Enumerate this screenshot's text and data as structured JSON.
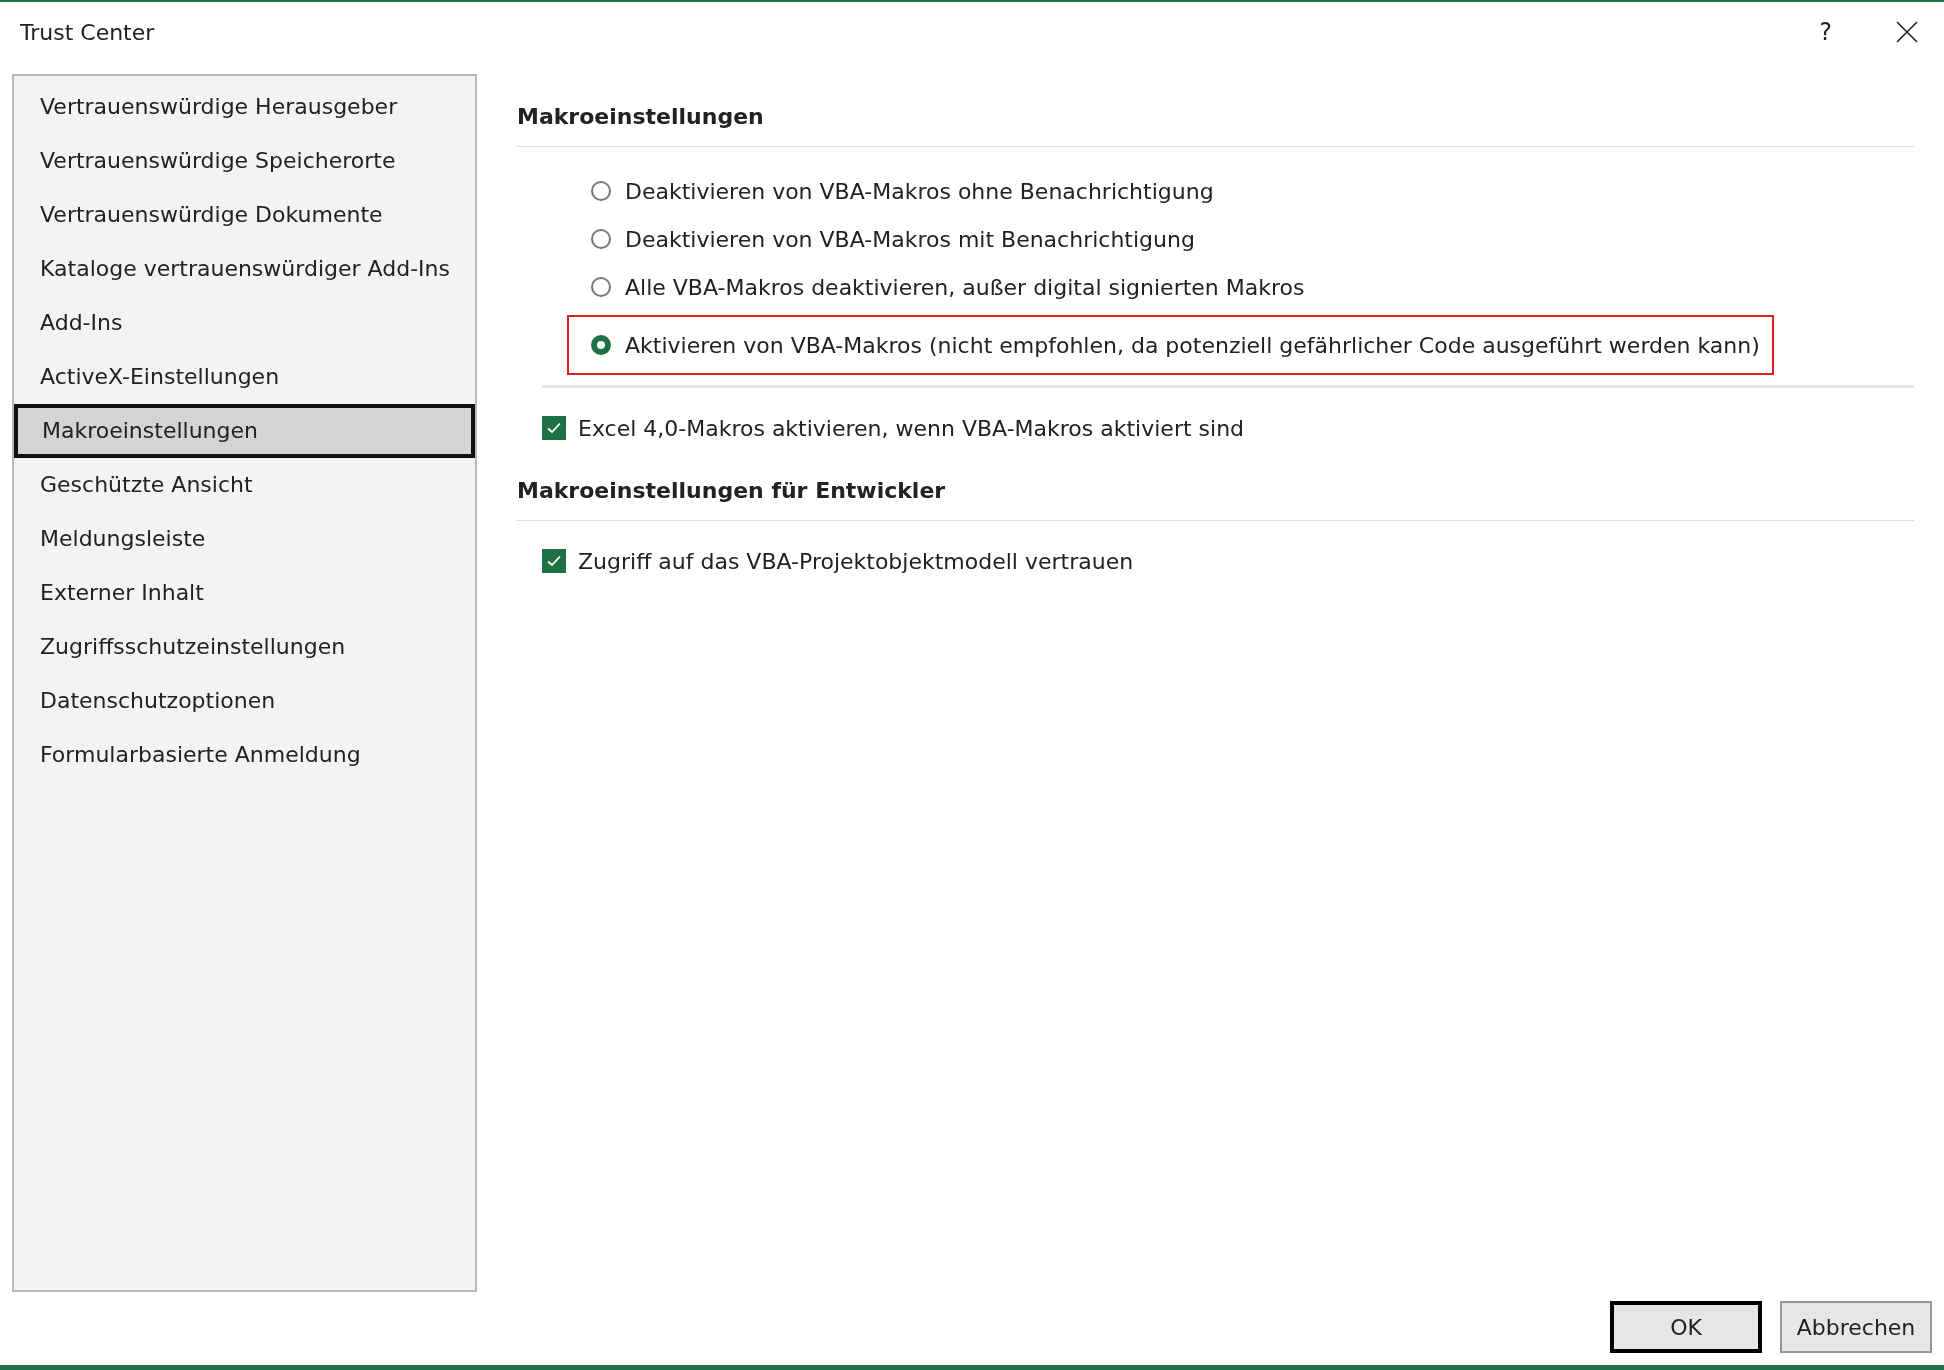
{
  "window": {
    "title": "Trust Center",
    "help": "?"
  },
  "sidebar": {
    "items": [
      {
        "label": "Vertrauenswürdige Herausgeber",
        "selected": false
      },
      {
        "label": "Vertrauenswürdige Speicherorte",
        "selected": false
      },
      {
        "label": "Vertrauenswürdige Dokumente",
        "selected": false
      },
      {
        "label": "Kataloge vertrauenswürdiger Add-Ins",
        "selected": false
      },
      {
        "label": "Add-Ins",
        "selected": false
      },
      {
        "label": "ActiveX-Einstellungen",
        "selected": false
      },
      {
        "label": "Makroeinstellungen",
        "selected": true
      },
      {
        "label": "Geschützte Ansicht",
        "selected": false
      },
      {
        "label": "Meldungsleiste",
        "selected": false
      },
      {
        "label": "Externer Inhalt",
        "selected": false
      },
      {
        "label": "Zugriffsschutzeinstellungen",
        "selected": false
      },
      {
        "label": "Datenschutzoptionen",
        "selected": false
      },
      {
        "label": "Formularbasierte Anmeldung",
        "selected": false
      }
    ]
  },
  "macro_settings": {
    "heading": "Makroeinstellungen",
    "options": [
      {
        "label": "Deaktivieren von VBA-Makros ohne Benachrichtigung",
        "selected": false,
        "highlighted": false
      },
      {
        "label": "Deaktivieren von VBA-Makros mit Benachrichtigung",
        "selected": false,
        "highlighted": false
      },
      {
        "label": "Alle VBA-Makros deaktivieren, außer digital signierten Makros",
        "selected": false,
        "highlighted": false
      },
      {
        "label": "Aktivieren von VBA-Makros (nicht empfohlen, da potenziell gefährlicher Code ausgeführt werden kann)",
        "selected": true,
        "highlighted": true
      }
    ],
    "excel4": {
      "label": "Excel 4,0-Makros aktivieren, wenn VBA-Makros aktiviert sind",
      "checked": true
    }
  },
  "developer_settings": {
    "heading": "Makroeinstellungen für Entwickler",
    "trust_vba": {
      "label": "Zugriff auf das VBA-Projektobjektmodell vertrauen",
      "checked": true
    }
  },
  "buttons": [
    {
      "label": "OK",
      "default": true
    },
    {
      "label": "Abbrechen",
      "default": false
    }
  ]
}
